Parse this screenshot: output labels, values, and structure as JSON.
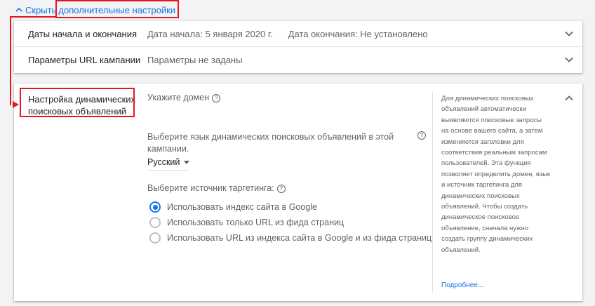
{
  "toggle": {
    "label_plain": "Скрыть ",
    "label_highlight": "дополнительные настройки"
  },
  "rows": [
    {
      "title": "Даты начала и окончания",
      "start": "Дата начала: 5 января 2020 г.",
      "end": "Дата окончания: Не установлено"
    },
    {
      "title": "Параметры URL кампании",
      "value": "Параметры не заданы"
    }
  ],
  "dsa": {
    "title": "Настройка динамических поисковых объявлений",
    "domain_label": "Укажите домен",
    "language_label": "Выберите язык динамических поисковых объявлений в этой кампании.",
    "language_value": "Русский",
    "source_label": "Выберите источник таргетинга:",
    "options": [
      "Использовать индекс сайта в Google",
      "Использовать только URL из фида страниц",
      "Использовать URL из индекса сайта в Google и из фида страниц"
    ],
    "selected_option": 0,
    "help_text": "Для динамических поисковых объявлений автоматически выявляются поисковые запросы на основе вашего сайта, а затем изменяются заголовки для соответствия реальным запросам пользователей. Эта функция позволяет определить домен, язык и источник таргетинга для динамических поисковых объявлений. Чтобы создать динамическое поисковое объявление, сначала нужно создать группу динамических объявлений.",
    "learn_more": "Подробнее..."
  },
  "colors": {
    "accent": "#1a73e8",
    "annotation": "#e8171e"
  }
}
